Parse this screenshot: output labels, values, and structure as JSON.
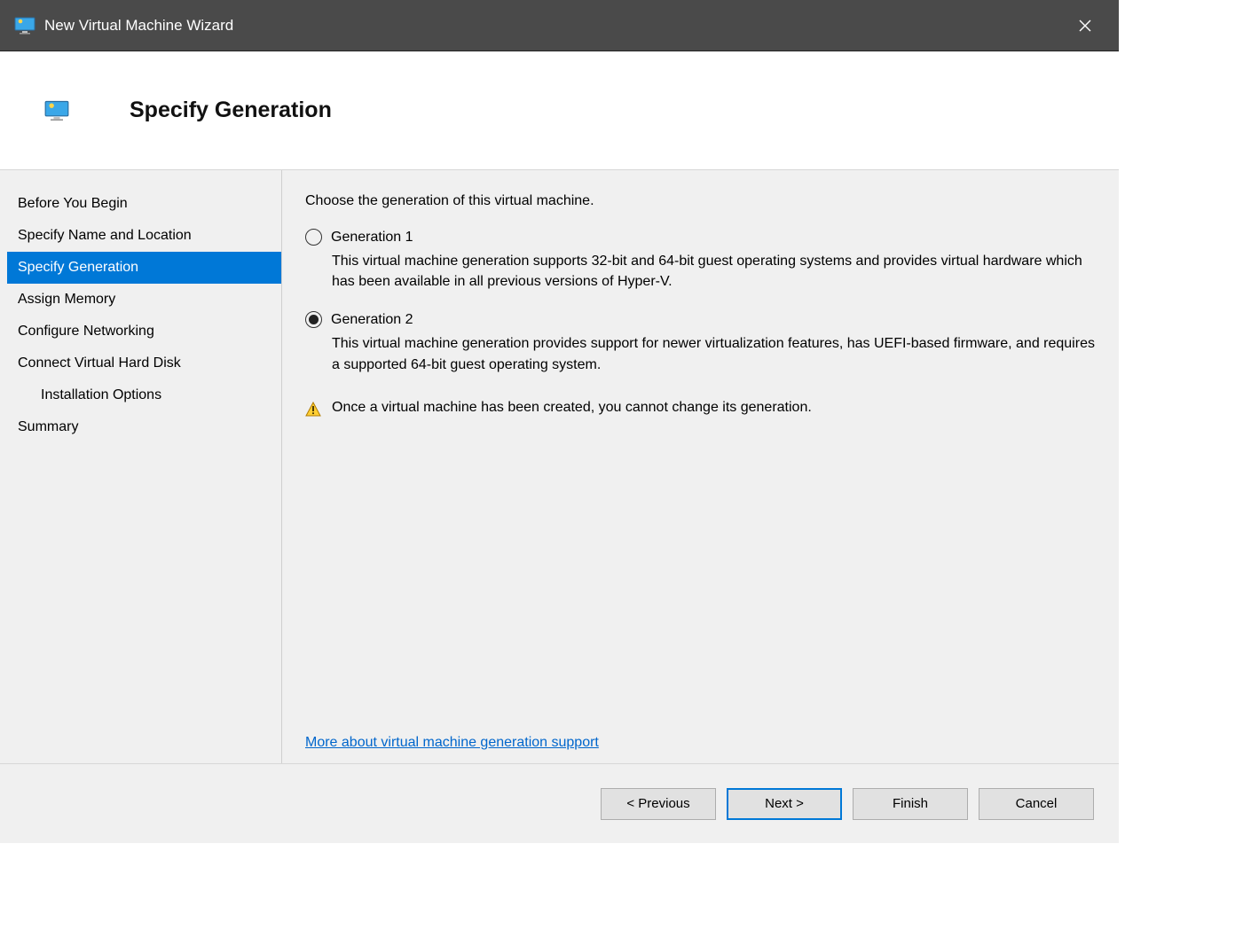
{
  "titlebar": {
    "title": "New Virtual Machine Wizard"
  },
  "header": {
    "heading": "Specify Generation"
  },
  "sidebar": {
    "steps": [
      {
        "label": "Before You Begin",
        "indent": false,
        "active": false
      },
      {
        "label": "Specify Name and Location",
        "indent": false,
        "active": false
      },
      {
        "label": "Specify Generation",
        "indent": false,
        "active": true
      },
      {
        "label": "Assign Memory",
        "indent": false,
        "active": false
      },
      {
        "label": "Configure Networking",
        "indent": false,
        "active": false
      },
      {
        "label": "Connect Virtual Hard Disk",
        "indent": false,
        "active": false
      },
      {
        "label": "Installation Options",
        "indent": true,
        "active": false
      },
      {
        "label": "Summary",
        "indent": false,
        "active": false
      }
    ]
  },
  "main": {
    "instruction": "Choose the generation of this virtual machine.",
    "options": [
      {
        "label": "Generation 1",
        "selected": false,
        "description": "This virtual machine generation supports 32-bit and 64-bit guest operating systems and provides virtual hardware which has been available in all previous versions of Hyper-V."
      },
      {
        "label": "Generation 2",
        "selected": true,
        "description": "This virtual machine generation provides support for newer virtualization features, has UEFI-based firmware, and requires a supported 64-bit guest operating system."
      }
    ],
    "warning": "Once a virtual machine has been created, you cannot change its generation.",
    "help_link": "More about virtual machine generation support"
  },
  "footer": {
    "previous": "< Previous",
    "next": "Next >",
    "finish": "Finish",
    "cancel": "Cancel"
  }
}
